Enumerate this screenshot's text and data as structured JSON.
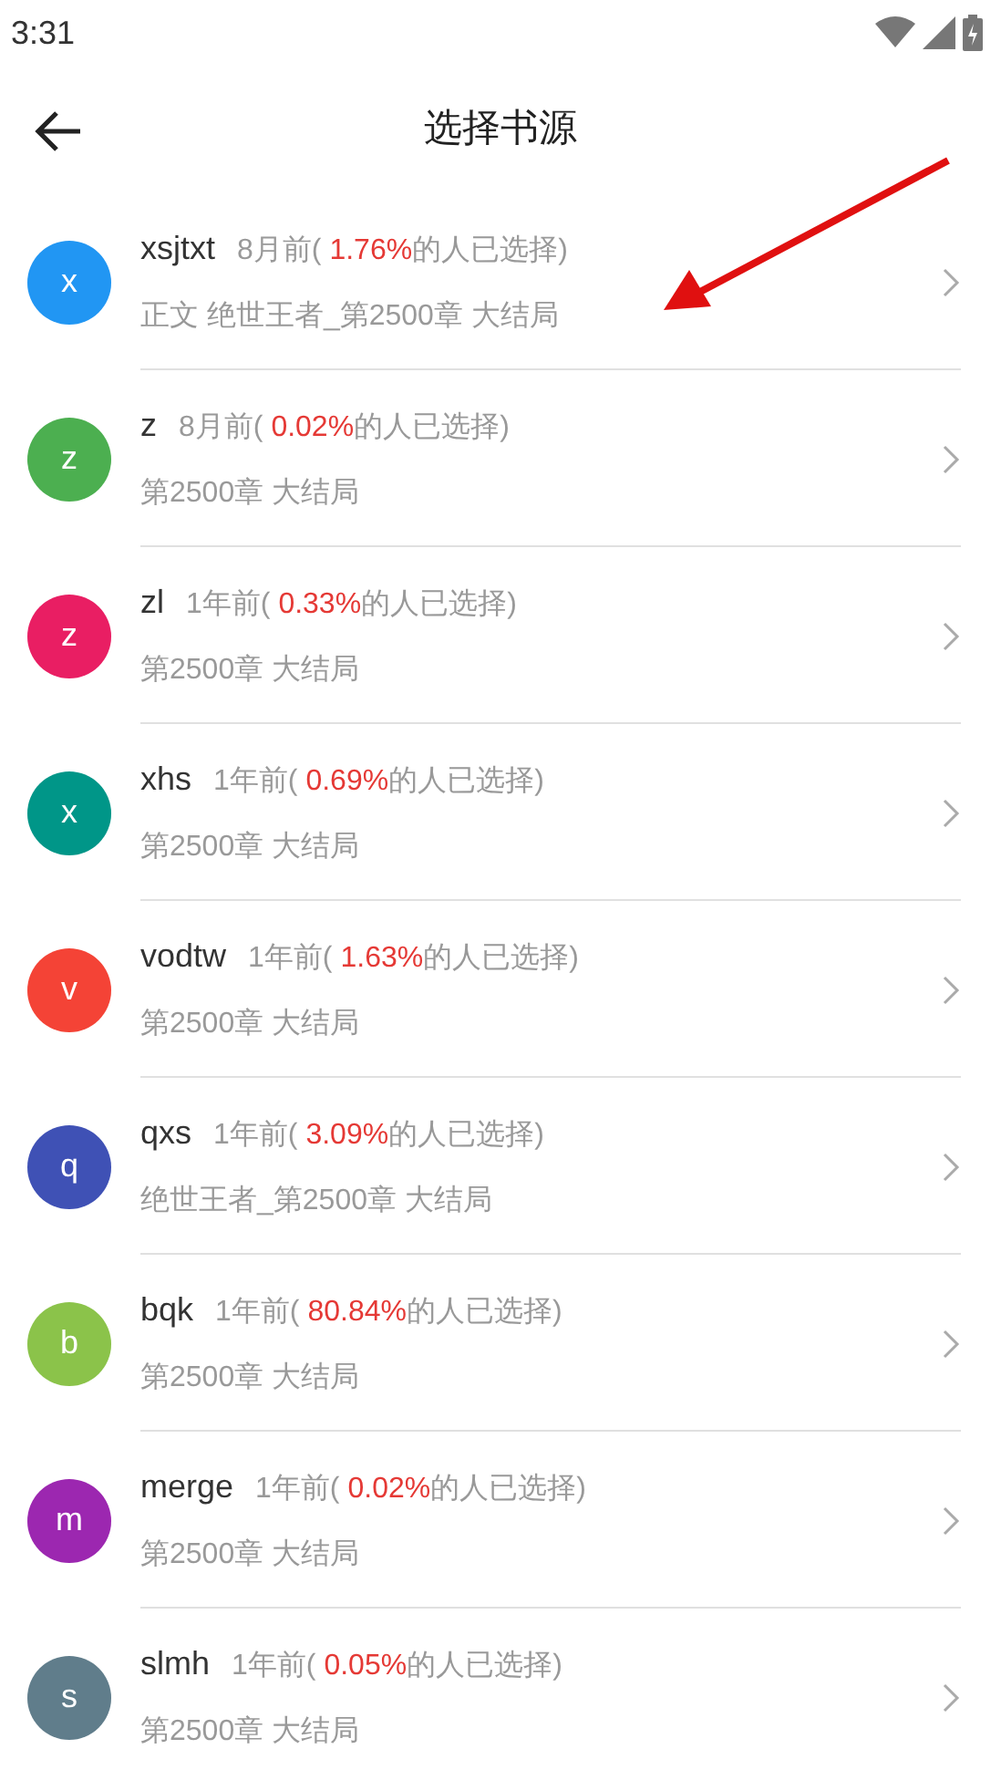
{
  "status_bar": {
    "time": "3:31"
  },
  "header": {
    "title": "选择书源"
  },
  "sources": [
    {
      "initial": "x",
      "color": "#2196f3",
      "name": "xsjtxt",
      "time": "8月前(",
      "percent": "1.76%",
      "suffix": "的人已选择)",
      "chapter": "正文 绝世王者_第2500章 大结局"
    },
    {
      "initial": "z",
      "color": "#4caf50",
      "name": "z",
      "time": "8月前(",
      "percent": "0.02%",
      "suffix": "的人已选择)",
      "chapter": "第2500章 大结局"
    },
    {
      "initial": "z",
      "color": "#e91e63",
      "name": "zl",
      "time": "1年前(",
      "percent": "0.33%",
      "suffix": "的人已选择)",
      "chapter": "第2500章 大结局"
    },
    {
      "initial": "x",
      "color": "#009688",
      "name": "xhs",
      "time": "1年前(",
      "percent": "0.69%",
      "suffix": "的人已选择)",
      "chapter": "第2500章 大结局"
    },
    {
      "initial": "v",
      "color": "#f44336",
      "name": "vodtw",
      "time": "1年前(",
      "percent": "1.63%",
      "suffix": "的人已选择)",
      "chapter": "第2500章 大结局"
    },
    {
      "initial": "q",
      "color": "#3f51b5",
      "name": "qxs",
      "time": "1年前(",
      "percent": "3.09%",
      "suffix": "的人已选择)",
      "chapter": "绝世王者_第2500章 大结局"
    },
    {
      "initial": "b",
      "color": "#8bc34a",
      "name": "bqk",
      "time": "1年前(",
      "percent": "80.84%",
      "suffix": "的人已选择)",
      "chapter": "第2500章 大结局"
    },
    {
      "initial": "m",
      "color": "#9c27b0",
      "name": "merge",
      "time": "1年前(",
      "percent": "0.02%",
      "suffix": "的人已选择)",
      "chapter": "第2500章 大结局"
    },
    {
      "initial": "s",
      "color": "#607d8b",
      "name": "slmh",
      "time": "1年前(",
      "percent": "0.05%",
      "suffix": "的人已选择)",
      "chapter": "第2500章 大结局"
    }
  ]
}
